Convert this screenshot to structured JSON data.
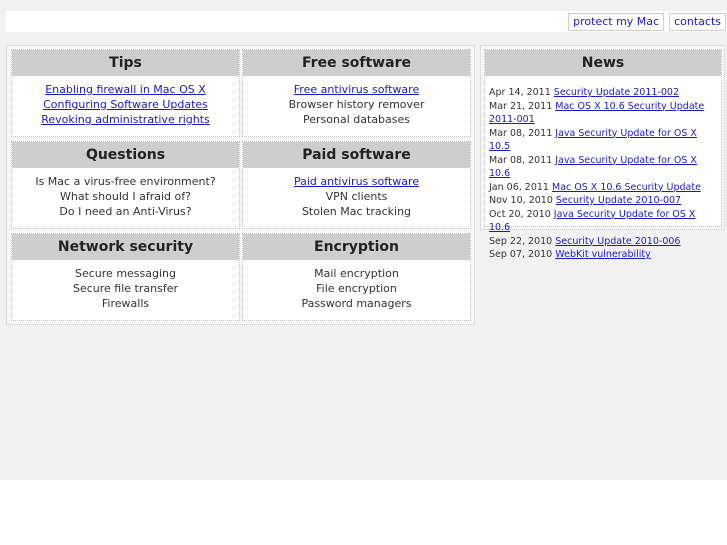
{
  "header": {
    "links": [
      {
        "label": "protect my Mac"
      },
      {
        "label": "contacts"
      }
    ]
  },
  "sections": {
    "tips": {
      "title": "Tips",
      "items": [
        {
          "label": "Enabling firewall in Mac OS X"
        },
        {
          "label": "Configuring Software Updates"
        },
        {
          "label": "Revoking administrative rights"
        }
      ]
    },
    "free_software": {
      "title": "Free software",
      "items": [
        {
          "label": "Free antivirus software"
        },
        {
          "label": "Browser history remover"
        },
        {
          "label": "Personal databases"
        }
      ]
    },
    "questions": {
      "title": "Questions",
      "items": [
        {
          "label": "Is Mac a virus-free environment?"
        },
        {
          "label": "What should I afraid of?"
        },
        {
          "label": "Do I need an Anti-Virus?"
        }
      ]
    },
    "paid_software": {
      "title": "Paid software",
      "items": [
        {
          "label": "Paid antivirus software"
        },
        {
          "label": "VPN clients"
        },
        {
          "label": "Stolen Mac tracking"
        }
      ]
    },
    "network_security": {
      "title": "Network security",
      "items": [
        {
          "label": "Secure messaging"
        },
        {
          "label": "Secure file transfer"
        },
        {
          "label": "Firewalls"
        }
      ]
    },
    "encryption": {
      "title": "Encryption",
      "items": [
        {
          "label": "Mail encryption"
        },
        {
          "label": "File encryption"
        },
        {
          "label": "Password managers"
        }
      ]
    }
  },
  "news": {
    "title": "News",
    "items": [
      {
        "date": "Apr 14, 2011",
        "label": "Security Update 2011-002"
      },
      {
        "date": "Mar 21, 2011",
        "label": "Mac OS X 10.6 Security Update 2011-001"
      },
      {
        "date": "Mar 08, 2011",
        "label": "Java Security Update for OS X 10.5"
      },
      {
        "date": "Mar 08, 2011",
        "label": "Java Security Update for OS X 10.6"
      },
      {
        "date": "Jan 06, 2011",
        "label": "Mac OS X 10.6 Security Update"
      },
      {
        "date": "Nov 10, 2010",
        "label": "Security Update 2010-007"
      },
      {
        "date": "Oct 20, 2010",
        "label": "Java Security Update for OS X 10.6"
      },
      {
        "date": "Sep 22, 2010",
        "label": "Security Update 2010-006"
      },
      {
        "date": "Sep 07, 2010",
        "label": "WebKit vulnerability"
      }
    ]
  }
}
